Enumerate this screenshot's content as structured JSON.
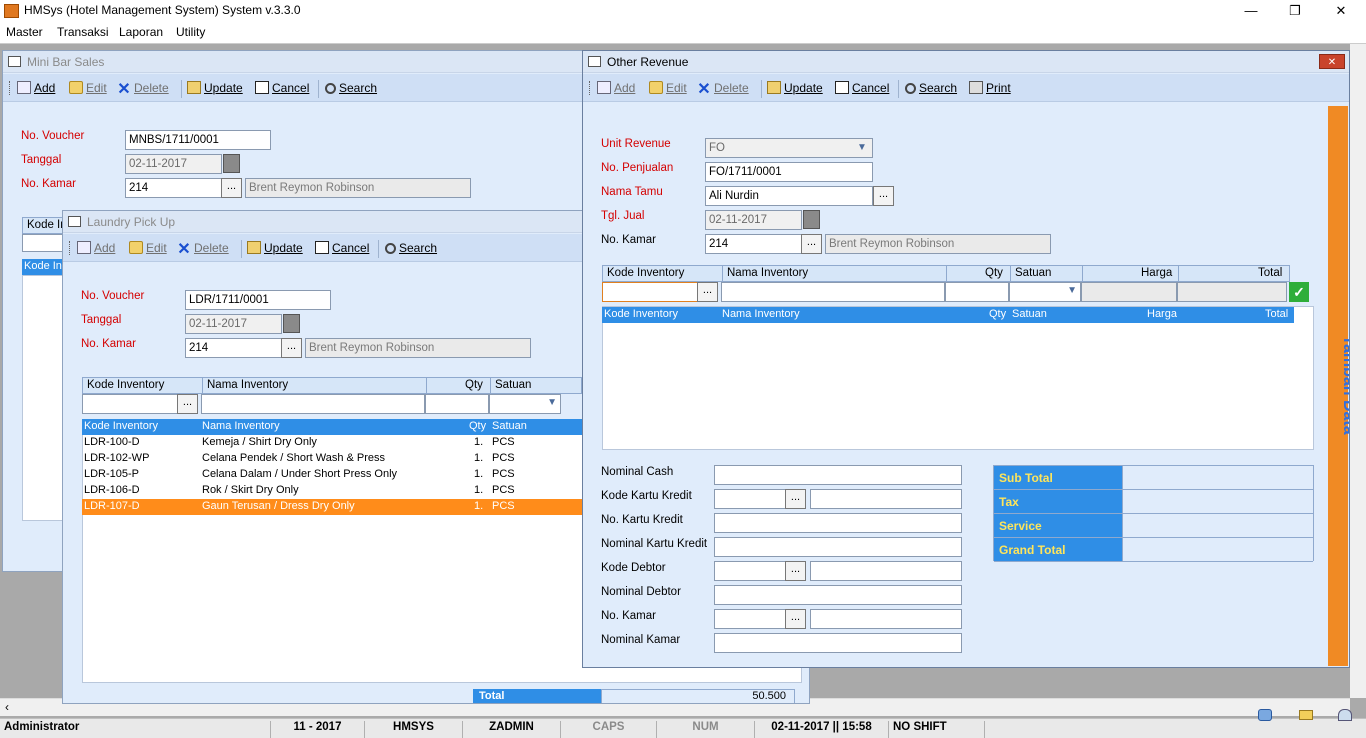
{
  "app": {
    "title": "HMSys (Hotel Management System) System v.3.3.0",
    "window_controls": {
      "minimize": "—",
      "maximize": "❐",
      "close": "✕"
    }
  },
  "menu": [
    "Master",
    "Transaksi",
    "Laporan",
    "Utility"
  ],
  "toolbar": {
    "add": "Add",
    "edit": "Edit",
    "delete": "Delete",
    "update": "Update",
    "cancel": "Cancel",
    "search": "Search",
    "print": "Print"
  },
  "minibar": {
    "title": "Mini Bar Sales",
    "voucher_label": "No. Voucher",
    "voucher": "MNBS/1711/0001",
    "tanggal_label": "Tanggal",
    "tanggal": "02-11-2017",
    "kamar_label": "No. Kamar",
    "kamar": "214",
    "guest": "Brent Reymon Robinson",
    "grid_head": "Kode In",
    "grid_row": "Kode In"
  },
  "laundry": {
    "title": "Laundry Pick Up",
    "voucher_label": "No. Voucher",
    "voucher": "LDR/1711/0001",
    "tanggal_label": "Tanggal",
    "tanggal": "02-11-2017",
    "kamar_label": "No. Kamar",
    "kamar": "214",
    "guest": "Brent Reymon Robinson",
    "col_kode": "Kode Inventory",
    "col_nama": "Nama Inventory",
    "col_qty": "Qty",
    "col_satuan": "Satuan",
    "rows": [
      {
        "kode": "LDR-100-D",
        "nama": "Kemeja / Shirt Dry Only",
        "qty": "1.",
        "satuan": "PCS"
      },
      {
        "kode": "LDR-102-WP",
        "nama": "Celana Pendek / Short Wash & Press",
        "qty": "1.",
        "satuan": "PCS"
      },
      {
        "kode": "LDR-105-P",
        "nama": "Celana Dalam / Under Short Press Only",
        "qty": "1.",
        "satuan": "PCS"
      },
      {
        "kode": "LDR-106-D",
        "nama": "Rok / Skirt Dry Only",
        "qty": "1.",
        "satuan": "PCS"
      },
      {
        "kode": "LDR-107-D",
        "nama": "Gaun Terusan / Dress Dry Only",
        "qty": "1.",
        "satuan": "PCS"
      }
    ],
    "total_label": "Total",
    "total_value": "50.500"
  },
  "other": {
    "title": "Other Revenue",
    "unit_label": "Unit Revenue",
    "unit": "FO",
    "penjualan_label": "No. Penjualan",
    "penjualan": "FO/1711/0001",
    "tamu_label": "Nama Tamu",
    "tamu": "Ali Nurdin",
    "tgl_label": "Tgl. Jual",
    "tgl": "02-11-2017",
    "kamar_label": "No. Kamar",
    "kamar": "214",
    "guest": "Brent Reymon Robinson",
    "col_kode": "Kode Inventory",
    "col_nama": "Nama Inventory",
    "col_qty": "Qty",
    "col_satuan": "Satuan",
    "col_harga": "Harga",
    "col_total": "Total",
    "pay_labels": [
      "Nominal Cash",
      "Kode Kartu Kredit",
      "No. Kartu Kredit",
      "Nominal Kartu Kredit",
      "Kode Debtor",
      "Nominal Debtor",
      "No. Kamar",
      "Nominal Kamar"
    ],
    "summary": [
      "Sub Total",
      "Tax",
      "Service",
      "Grand Total"
    ],
    "side_tab": "Tambah Data"
  },
  "status": {
    "user": "Administrator",
    "period": "11 - 2017",
    "db": "HMSYS",
    "login": "ZADMIN",
    "caps": "CAPS",
    "num": "NUM",
    "datetime": "02-11-2017 || 15:58",
    "shift": "NO SHIFT"
  },
  "colors": {
    "accent": "#2f8ee6",
    "selected_row": "#ff8c1a",
    "required_label": "#d40000",
    "side_tab": "#f08a24"
  }
}
